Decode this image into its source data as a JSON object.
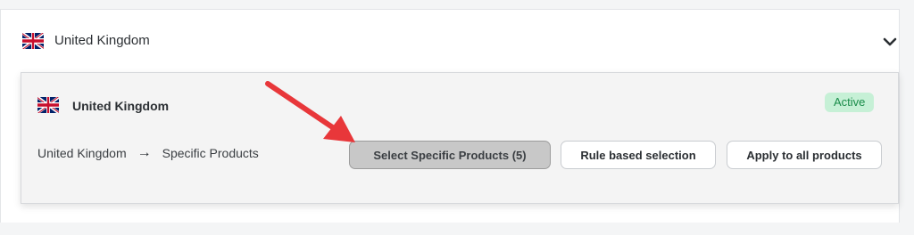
{
  "header": {
    "country": "United Kingdom",
    "flag_icon": "uk-flag-icon",
    "toggle_icon": "chevron-down-icon"
  },
  "card": {
    "country": "United Kingdom",
    "status": "Active",
    "path": {
      "country": "United Kingdom",
      "separator": "→",
      "mode": "Specific Products"
    },
    "buttons": {
      "select_specific": "Select Specific Products (5)",
      "rule_based": "Rule based selection",
      "apply_all": "Apply to all products"
    }
  },
  "colors": {
    "active_badge_bg": "#c6f0d6",
    "active_badge_text": "#1a8c4a",
    "annotation_arrow": "#e8373a",
    "selected_button_bg": "#c8c8c8"
  }
}
